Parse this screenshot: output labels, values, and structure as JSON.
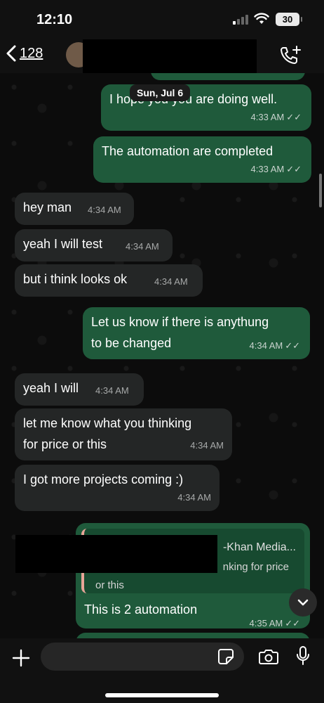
{
  "status_bar": {
    "time": "12:10",
    "battery": "30"
  },
  "header": {
    "back_count": "128"
  },
  "chat": {
    "date_pill": "Sun, Jul 6",
    "messages": [
      {
        "text": "I hope you you are doing well.",
        "time": "4:33 AM",
        "ticks": "✓✓"
      },
      {
        "text": "The automation are completed",
        "time": "4:33 AM",
        "ticks": "✓✓"
      },
      {
        "text": "hey man",
        "time": "4:34 AM"
      },
      {
        "text": "yeah I will test",
        "time": "4:34 AM"
      },
      {
        "text": "but i think looks ok",
        "time": "4:34 AM"
      },
      {
        "line1": "Let us know if there is anythung",
        "line2": "to be changed",
        "time": "4:34 AM",
        "ticks": "✓✓"
      },
      {
        "text": "yeah I will",
        "time": "4:34 AM"
      },
      {
        "line1": "let me know what you thinking",
        "line2": "for price or this",
        "time": "4:34 AM"
      },
      {
        "text": "I got more projects coming :)",
        "time": "4:34 AM"
      },
      {
        "quote_title": "-Khan Media...",
        "quote_line1": "nking for price",
        "quote_line2": "or this",
        "text": "This is 2 automation",
        "time": "4:35 AM",
        "ticks": "✓✓"
      }
    ]
  },
  "composer": {
    "placeholder": ""
  }
}
